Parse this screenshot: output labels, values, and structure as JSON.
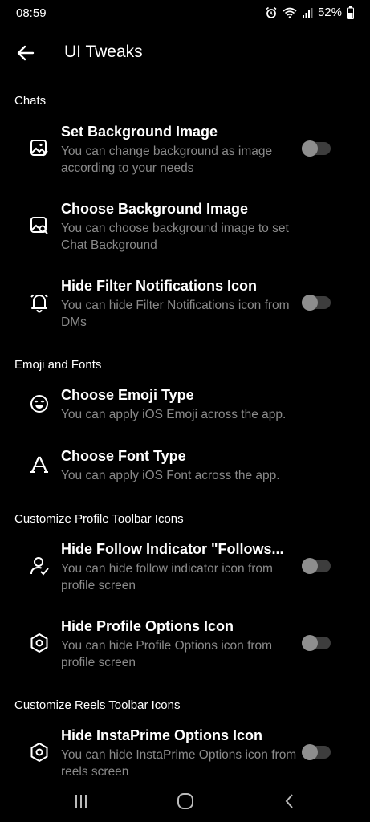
{
  "status_bar": {
    "time": "08:59",
    "battery": "52%"
  },
  "app_bar": {
    "title": "UI Tweaks"
  },
  "sections": [
    {
      "header": "Chats"
    },
    {
      "header": "Emoji and Fonts"
    },
    {
      "header": "Customize Profile Toolbar Icons"
    },
    {
      "header": "Customize Reels Toolbar Icons"
    }
  ],
  "items": [
    {
      "title": "Set Background Image",
      "desc": "You can change background as image according to your needs",
      "icon": "image-edit-icon",
      "toggle": false
    },
    {
      "title": "Choose Background Image",
      "desc": "You can choose background image to set Chat Background",
      "icon": "image-search-icon"
    },
    {
      "title": "Hide Filter Notifications Icon",
      "desc": "You can hide Filter Notifications icon from DMs",
      "icon": "bell-icon",
      "toggle": false
    },
    {
      "title": "Choose Emoji Type",
      "desc": "You can apply iOS Emoji across the app.",
      "icon": "emoji-icon"
    },
    {
      "title": "Choose Font Type",
      "desc": "You can apply iOS Font across the app.",
      "icon": "font-icon"
    },
    {
      "title": "Hide Follow Indicator \"Follows...",
      "desc": "You can hide follow indicator icon from profile screen",
      "icon": "user-check-icon",
      "toggle": false
    },
    {
      "title": "Hide Profile Options Icon",
      "desc": "You can hide Profile Options icon from profile screen",
      "icon": "hexagon-settings-icon",
      "toggle": false
    },
    {
      "title": "Hide InstaPrime Options Icon",
      "desc": "You can hide InstaPrime Options icon from reels screen",
      "icon": "hexagon-settings-icon",
      "toggle": false
    }
  ]
}
